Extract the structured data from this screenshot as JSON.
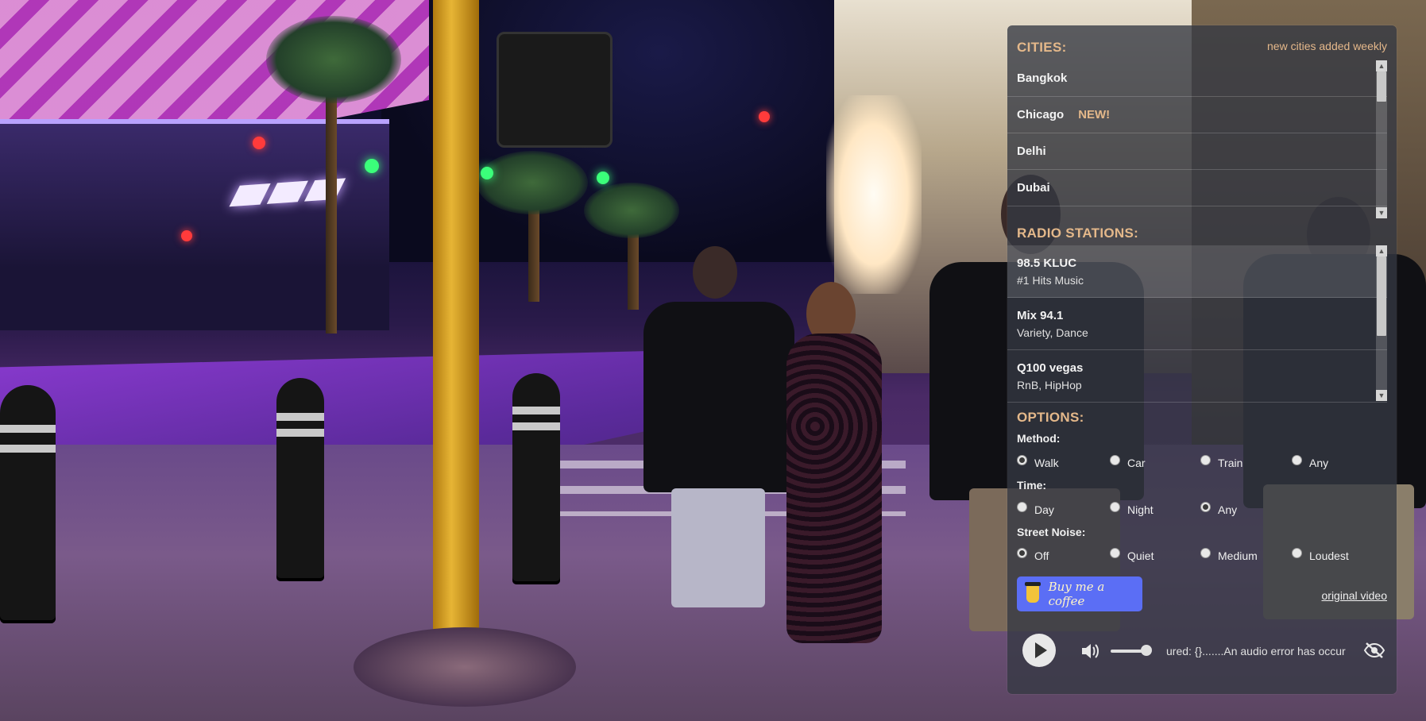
{
  "cities": {
    "title": "CITIES:",
    "note": "new cities added weekly",
    "items": [
      {
        "name": "Bangkok",
        "badge": ""
      },
      {
        "name": "Chicago",
        "badge": "NEW!"
      },
      {
        "name": "Delhi",
        "badge": ""
      },
      {
        "name": "Dubai",
        "badge": ""
      }
    ]
  },
  "radio": {
    "title": "RADIO STATIONS:",
    "stations": [
      {
        "name": "98.5 KLUC",
        "genre": "#1 Hits Music"
      },
      {
        "name": "Mix 94.1",
        "genre": "Variety, Dance"
      },
      {
        "name": "Q100 vegas",
        "genre": "RnB, HipHop"
      }
    ]
  },
  "options": {
    "title": "OPTIONS:",
    "method": {
      "label": "Method:",
      "choices": [
        "Walk",
        "Car",
        "Train",
        "Any"
      ],
      "selected": "Walk"
    },
    "time": {
      "label": "Time:",
      "choices": [
        "Day",
        "Night",
        "Any"
      ],
      "selected": "Any"
    },
    "noise": {
      "label": "Street Noise:",
      "choices": [
        "Off",
        "Quiet",
        "Medium",
        "Loudest"
      ],
      "selected": "Off"
    }
  },
  "footer": {
    "coffee_label": "Buy me a coffee",
    "original_link": "original video"
  },
  "player": {
    "error_text": "ured: {}.......An audio error has occur",
    "volume_level": 0.85
  },
  "colors": {
    "accent": "#e4b88a",
    "coffee_button": "#5b6ef5",
    "panel": "rgba(52,56,66,0.78)"
  },
  "icons": {
    "play": "play-icon",
    "volume": "volume-icon",
    "hide": "eye-slash-icon",
    "coffee": "coffee-cup-icon"
  }
}
